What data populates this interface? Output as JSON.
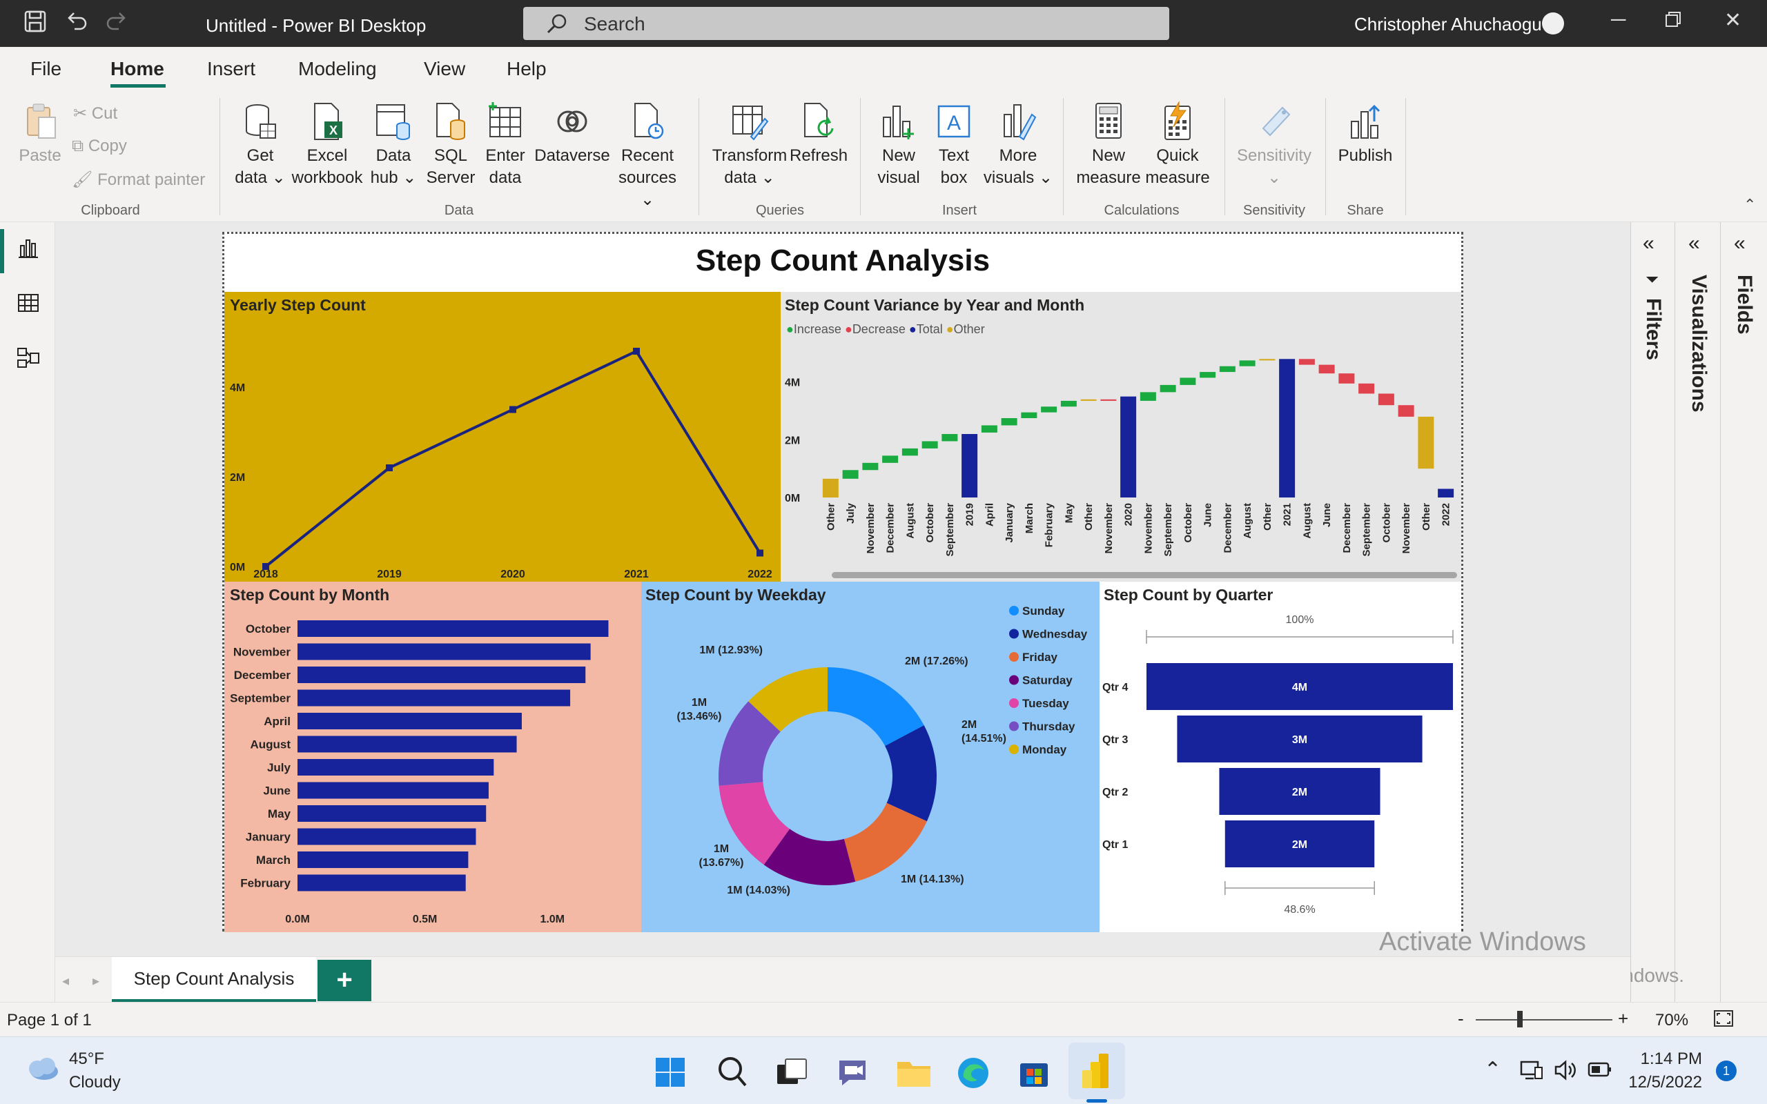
{
  "titlebar": {
    "title": "Untitled - Power BI Desktop",
    "search_placeholder": "Search",
    "user": "Christopher Ahuchaogu"
  },
  "menu": [
    "File",
    "Home",
    "Insert",
    "Modeling",
    "View",
    "Help"
  ],
  "menu_active": "Home",
  "ribbon": {
    "clipboard": {
      "paste": "Paste",
      "cut": "Cut",
      "copy": "Copy",
      "format_painter": "Format painter",
      "group": "Clipboard"
    },
    "data": {
      "get_data": [
        "Get",
        "data ⌄"
      ],
      "excel": [
        "Excel",
        "workbook"
      ],
      "data_hub": [
        "Data",
        "hub ⌄"
      ],
      "sql": [
        "SQL",
        "Server"
      ],
      "enter": [
        "Enter",
        "data"
      ],
      "dataverse": "Dataverse",
      "recent": [
        "Recent",
        "sources ⌄"
      ],
      "group": "Data"
    },
    "queries": {
      "transform": [
        "Transform",
        "data ⌄"
      ],
      "refresh": "Refresh",
      "group": "Queries"
    },
    "insert": {
      "new_visual": [
        "New",
        "visual"
      ],
      "text_box": [
        "Text",
        "box"
      ],
      "more_visuals": [
        "More",
        "visuals ⌄"
      ],
      "group": "Insert"
    },
    "calculations": {
      "new_measure": [
        "New",
        "measure"
      ],
      "quick_measure": [
        "Quick",
        "measure"
      ],
      "group": "Calculations"
    },
    "sensitivity": {
      "label": "Sensitivity",
      "group": "Sensitivity"
    },
    "share": {
      "publish": "Publish",
      "group": "Share"
    }
  },
  "side_panes": {
    "filters": "Filters",
    "visualizations": "Visualizations",
    "fields": "Fields"
  },
  "report": {
    "title": "Step Count Analysis",
    "yearly": {
      "title": "Yearly Step Count",
      "bg": "#d4aa00",
      "line_color": "#1a237e"
    },
    "variance": {
      "title": "Step Count Variance by Year and Month",
      "legend": [
        {
          "label": "Increase",
          "color": "#1aab40"
        },
        {
          "label": "Decrease",
          "color": "#e0424e"
        },
        {
          "label": "Total",
          "color": "#16239b"
        },
        {
          "label": "Other",
          "color": "#d4aa1a"
        }
      ]
    },
    "month": {
      "title": "Step Count by Month",
      "bg": "#f4b9a5"
    },
    "weekday": {
      "title": "Step Count by Weekday",
      "bg": "#91c8f8"
    },
    "quarter": {
      "title": "Step Count by Quarter",
      "top_label": "100%",
      "bottom_label": "48.6%"
    }
  },
  "chart_data": [
    {
      "type": "line",
      "title": "Yearly Step Count",
      "x": [
        "2018",
        "2019",
        "2020",
        "2021",
        "2022"
      ],
      "y": [
        0,
        2.2,
        3.5,
        4.8,
        0.3
      ],
      "y_unit": "M",
      "yticks": [
        "0M",
        "2M",
        "4M"
      ],
      "ylim": [
        0,
        5.2
      ]
    },
    {
      "type": "bar",
      "subtype": "waterfall",
      "title": "Step Count Variance by Year and Month",
      "categories": [
        "Other",
        "July",
        "November",
        "December",
        "August",
        "October",
        "September",
        "2019",
        "April",
        "January",
        "March",
        "February",
        "May",
        "Other",
        "November",
        "2020",
        "November",
        "September",
        "October",
        "June",
        "December",
        "August",
        "Other",
        "2021",
        "August",
        "June",
        "December",
        "September",
        "October",
        "November",
        "Other",
        "2022"
      ],
      "kinds": [
        "other",
        "inc",
        "inc",
        "inc",
        "inc",
        "inc",
        "inc",
        "total",
        "inc",
        "inc",
        "inc",
        "inc",
        "inc",
        "other",
        "dec",
        "total",
        "inc",
        "inc",
        "inc",
        "inc",
        "inc",
        "inc",
        "other",
        "total",
        "dec",
        "dec",
        "dec",
        "dec",
        "dec",
        "dec",
        "other",
        "total"
      ],
      "starts": [
        0,
        0.65,
        0.95,
        1.2,
        1.45,
        1.7,
        1.95,
        0,
        2.25,
        2.5,
        2.75,
        2.95,
        3.15,
        3.35,
        3.4,
        0,
        3.35,
        3.65,
        3.9,
        4.15,
        4.35,
        4.55,
        4.75,
        0,
        4.8,
        4.6,
        4.3,
        3.95,
        3.6,
        3.2,
        2.8,
        0
      ],
      "ends": [
        0.65,
        0.95,
        1.2,
        1.45,
        1.7,
        1.95,
        2.2,
        2.2,
        2.5,
        2.75,
        2.95,
        3.15,
        3.35,
        3.4,
        3.35,
        3.5,
        3.65,
        3.9,
        4.15,
        4.35,
        4.55,
        4.75,
        4.8,
        4.8,
        4.6,
        4.3,
        3.95,
        3.6,
        3.2,
        2.8,
        1.0,
        0.3
      ],
      "yticks": [
        "0M",
        "2M",
        "4M"
      ],
      "ylim": [
        0,
        5.5
      ]
    },
    {
      "type": "bar",
      "orientation": "horizontal",
      "title": "Step Count by Month",
      "categories": [
        "October",
        "November",
        "December",
        "September",
        "April",
        "August",
        "July",
        "June",
        "May",
        "January",
        "March",
        "February"
      ],
      "values": [
        1.22,
        1.15,
        1.13,
        1.07,
        0.88,
        0.86,
        0.77,
        0.75,
        0.74,
        0.7,
        0.67,
        0.66
      ],
      "unit": "M",
      "xticks": [
        "0.0M",
        "0.5M",
        "1.0M"
      ],
      "xlim": [
        0,
        1.3
      ]
    },
    {
      "type": "pie",
      "subtype": "donut",
      "title": "Step Count by Weekday",
      "labels": [
        "Sunday",
        "Wednesday",
        "Friday",
        "Saturday",
        "Tuesday",
        "Thursday",
        "Monday"
      ],
      "values": [
        17.26,
        14.51,
        14.13,
        14.03,
        13.67,
        13.46,
        12.93
      ],
      "data_labels": [
        "2M (17.26%)",
        "2M (14.51%)",
        "1M (14.13%)",
        "1M (14.03%)",
        "1M (13.67%)",
        "1M (13.46%)",
        "1M (12.93%)"
      ],
      "colors": [
        "#118dff",
        "#12239e",
        "#e66c37",
        "#6b007b",
        "#e044a7",
        "#744ec2",
        "#d9b300"
      ]
    },
    {
      "type": "bar",
      "subtype": "funnel",
      "title": "Step Count by Quarter",
      "categories": [
        "Qtr 4",
        "Qtr 3",
        "Qtr 2",
        "Qtr 1"
      ],
      "values": [
        4.0,
        3.2,
        2.1,
        1.95
      ],
      "data_labels": [
        "4M",
        "3M",
        "2M",
        "2M"
      ]
    }
  ],
  "pagetabs": {
    "tabs": [
      "Step Count Analysis"
    ],
    "add": "+"
  },
  "watermark": {
    "line1": "Activate Windows",
    "line2": "Go to Settings to activate Windows."
  },
  "statusbar": {
    "page": "Page 1 of 1",
    "zoom": "70%"
  },
  "taskbar": {
    "weather_temp": "45°F",
    "weather_desc": "Cloudy",
    "time": "1:14 PM",
    "date": "12/5/2022",
    "badge": "1"
  }
}
